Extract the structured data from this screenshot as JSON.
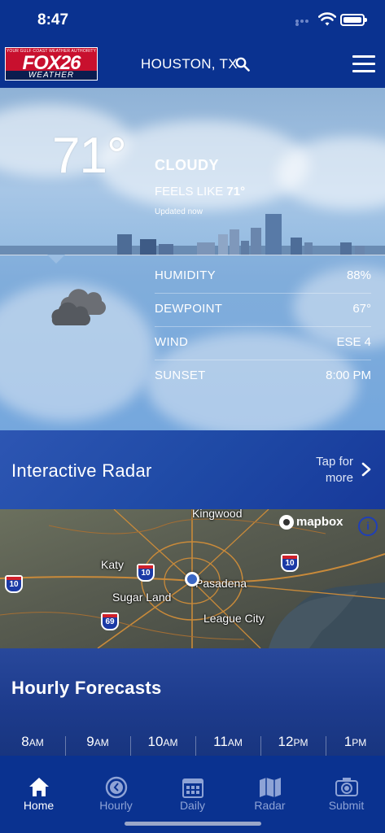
{
  "status_bar": {
    "time": "8:47"
  },
  "header": {
    "logo": {
      "tagline": "YOUR GULF COAST WEATHER AUTHORITY",
      "brand": "FOX26",
      "sub": "WEATHER"
    },
    "location": "HOUSTON, TX",
    "search_icon": "search-icon",
    "menu_icon": "hamburger-menu-icon"
  },
  "current": {
    "temperature": "71°",
    "condition": "CLOUDY",
    "feels_like_label": "FEELS LIKE",
    "feels_like_value": "71°",
    "updated": "Updated now",
    "icon": "cloudy-icon",
    "stats": [
      {
        "label": "HUMIDITY",
        "value": "88%"
      },
      {
        "label": "DEWPOINT",
        "value": "67°"
      },
      {
        "label": "WIND",
        "value": "ESE 4"
      },
      {
        "label": "SUNSET",
        "value": "8:00 PM"
      }
    ]
  },
  "radar": {
    "title": "Interactive Radar",
    "tap_label_1": "Tap for",
    "tap_label_2": "more",
    "map": {
      "attribution": "mapbox",
      "info_label": "i",
      "places": [
        "Kingwood",
        "Katy",
        "Sugar Land",
        "Pasadena",
        "League City"
      ],
      "highways": [
        "10",
        "10",
        "10",
        "69"
      ]
    }
  },
  "hourly": {
    "title": "Hourly Forecasts",
    "hours": [
      {
        "h": "8",
        "p": "AM"
      },
      {
        "h": "9",
        "p": "AM"
      },
      {
        "h": "10",
        "p": "AM"
      },
      {
        "h": "11",
        "p": "AM"
      },
      {
        "h": "12",
        "p": "PM"
      },
      {
        "h": "1",
        "p": "PM"
      }
    ]
  },
  "tabs": [
    {
      "label": "Home",
      "icon": "home-icon",
      "active": true
    },
    {
      "label": "Hourly",
      "icon": "clock-icon",
      "active": false
    },
    {
      "label": "Daily",
      "icon": "calendar-icon",
      "active": false
    },
    {
      "label": "Radar",
      "icon": "map-icon",
      "active": false
    },
    {
      "label": "Submit",
      "icon": "camera-icon",
      "active": false
    }
  ],
  "colors": {
    "brand_blue": "#0a3290",
    "brand_red": "#c8102e",
    "inactive_tab": "#8ea3d6"
  }
}
